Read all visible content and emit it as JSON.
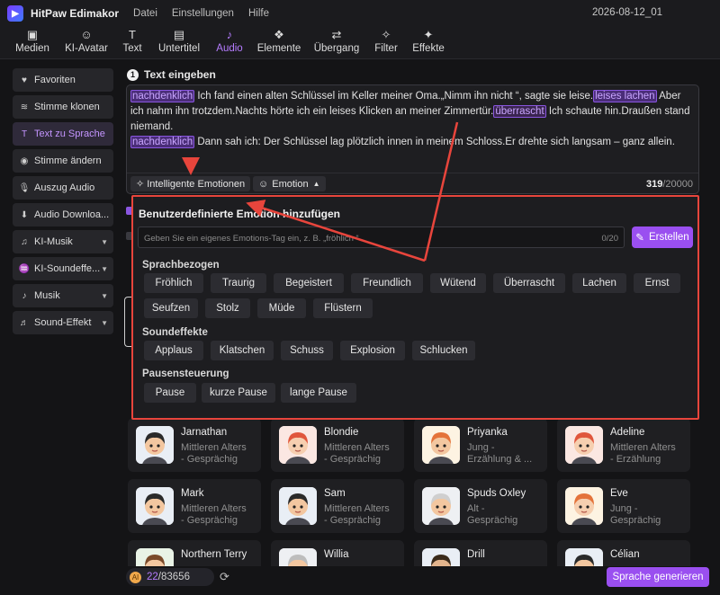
{
  "app": {
    "name": "HitPaw Edimakor",
    "menus": [
      "Datei",
      "Einstellungen",
      "Hilfe"
    ],
    "date": "2026-08-12_01"
  },
  "toolbar": [
    {
      "label": "Medien",
      "icon": "media-icon",
      "glyph": "▣"
    },
    {
      "label": "KI-Avatar",
      "icon": "ai-avatar-icon",
      "glyph": "☺"
    },
    {
      "label": "Text",
      "icon": "text-icon",
      "glyph": "T"
    },
    {
      "label": "Untertitel",
      "icon": "subtitle-icon",
      "glyph": "▤"
    },
    {
      "label": "Audio",
      "icon": "audio-icon",
      "glyph": "♪",
      "active": true
    },
    {
      "label": "Elemente",
      "icon": "elements-icon",
      "glyph": "❖"
    },
    {
      "label": "Übergang",
      "icon": "transition-icon",
      "glyph": "⇄"
    },
    {
      "label": "Filter",
      "icon": "filter-icon",
      "glyph": "✧"
    },
    {
      "label": "Effekte",
      "icon": "effects-icon",
      "glyph": "✦"
    }
  ],
  "sidebar": [
    {
      "label": "Favoriten",
      "icon": "heart-icon",
      "glyph": "♥"
    },
    {
      "label": "Stimme klonen",
      "icon": "voice-clone-icon",
      "glyph": "≋"
    },
    {
      "label": "Text zu Sprache",
      "icon": "text-to-speech-icon",
      "glyph": "T",
      "active": true
    },
    {
      "label": "Stimme ändern",
      "icon": "voice-change-icon",
      "glyph": "◉"
    },
    {
      "label": "Auszug Audio",
      "icon": "microphone-icon",
      "glyph": "🎙"
    },
    {
      "label": "Audio Downloa...",
      "icon": "download-icon",
      "glyph": "⬇"
    },
    {
      "label": "KI-Musik",
      "icon": "ai-music-icon",
      "glyph": "♫",
      "caret": true
    },
    {
      "label": "KI-Soundeffe...",
      "icon": "ai-sound-icon",
      "glyph": "♒",
      "caret": true
    },
    {
      "label": "Musik",
      "icon": "music-icon",
      "glyph": "♪",
      "caret": true
    },
    {
      "label": "Sound-Effekt",
      "icon": "sound-effect-icon",
      "glyph": "♬",
      "caret": true
    }
  ],
  "step1": {
    "num": "1",
    "label": "Text eingeben"
  },
  "editor": {
    "tag1": "nachdenklich",
    "seg1": " Ich fand einen alten Schlüssel im Keller meiner Oma.„Nimm ihn nicht “, sagte sie leise.",
    "tag2": "leises lachen",
    "seg2": " Aber ich nahm ihn trotzdem.Nachts hörte ich ein leises Klicken an meiner Zimmertür.",
    "tag3": "überrascht",
    "seg3": " Ich schaute hin.Draußen stand niemand.",
    "tag4": "nachdenklich",
    "seg4": " Dann sah ich: Der Schlüssel lag plötzlich innen in meinem Schloss.Er drehte sich langsam – ganz allein.",
    "smart_emotions": "Intelligente Emotionen",
    "emotion_btn": "Emotion",
    "count": "319",
    "max": "/20000"
  },
  "popup": {
    "title": "Benutzerdefinierte Emotion hinzufügen",
    "placeholder": "Geben Sie ein eigenes Emotions-Tag ein, z. B. „fröhlich “",
    "counter": "0/20",
    "create": "Erstellen",
    "sec_speech": "Sprachbezogen",
    "speech": [
      "Fröhlich",
      "Traurig",
      "Begeistert",
      "Freundlich",
      "Wütend",
      "Überrascht",
      "Lachen",
      "Ernst",
      "Seufzen",
      "Stolz",
      "Müde",
      "Flüstern"
    ],
    "sec_sfx": "Soundeffekte",
    "sfx": [
      "Applaus",
      "Klatschen",
      "Schuss",
      "Explosion",
      "Schlucken"
    ],
    "sec_pause": "Pausensteuerung",
    "pause": [
      "Pause",
      "kurze Pause",
      "lange Pause"
    ]
  },
  "voices": [
    {
      "name": "Jarnathan",
      "desc1": "Mittleren Alters",
      "desc2": "- Gesprächig",
      "hair": "#2a2a2a",
      "skin": "#f3c7a0",
      "bg": "#e9eef5"
    },
    {
      "name": "Blondie",
      "desc1": "Mittleren Alters",
      "desc2": "- Gesprächig",
      "hair": "#e0563c",
      "skin": "#f6cfb0",
      "bg": "#fbe7e2"
    },
    {
      "name": "Priyanka",
      "desc1": "Jung -",
      "desc2": "Erzählung & ...",
      "hair": "#e4733a",
      "skin": "#f3c7a0",
      "bg": "#fdf3e2"
    },
    {
      "name": "Adeline",
      "desc1": "Mittleren Alters",
      "desc2": "- Erzählung",
      "hair": "#e0563c",
      "skin": "#f6cfb0",
      "bg": "#fbe7e2"
    },
    {
      "name": "Mark",
      "desc1": "Mittleren Alters",
      "desc2": "- Gesprächig",
      "hair": "#2a2a2a",
      "skin": "#f3c7a0",
      "bg": "#e9eef5"
    },
    {
      "name": "Sam",
      "desc1": "Mittleren Alters",
      "desc2": "- Gesprächig",
      "hair": "#2a2a2a",
      "skin": "#f3c7a0",
      "bg": "#e9eef5"
    },
    {
      "name": "Spuds Oxley",
      "desc1": "Alt -",
      "desc2": "Gesprächig",
      "hair": "#cfcfcf",
      "skin": "#f3c7a0",
      "bg": "#eef0f3"
    },
    {
      "name": "Eve",
      "desc1": "Jung -",
      "desc2": "Gesprächig",
      "hair": "#e4733a",
      "skin": "#f6cfb0",
      "bg": "#fdf3e2"
    },
    {
      "name": "Northern Terry",
      "desc1": "",
      "desc2": "",
      "hair": "#7a4a2a",
      "skin": "#f3c7a0",
      "bg": "#e9f3e6"
    },
    {
      "name": "Willia",
      "desc1": "",
      "desc2": "",
      "hair": "#bdbdbd",
      "skin": "#f3c7a0",
      "bg": "#eef0f3"
    },
    {
      "name": "Drill",
      "desc1": "",
      "desc2": "",
      "hair": "#3a2a1a",
      "skin": "#e3b48c",
      "bg": "#e9eef5"
    },
    {
      "name": "Célian",
      "desc1": "",
      "desc2": "",
      "hair": "#2a2a2a",
      "skin": "#f3c7a0",
      "bg": "#e9eef5"
    }
  ],
  "footer": {
    "credits_used": "22",
    "credits_total": "/83656",
    "generate": "Sprache generieren"
  },
  "colors": {
    "accent": "#9a4ff0",
    "highlight_border": "#e8453c"
  }
}
